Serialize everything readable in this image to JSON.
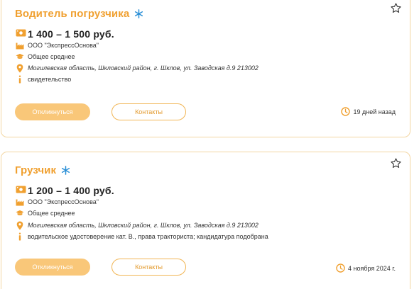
{
  "colors": {
    "accent": "#f0a030",
    "button_fill": "#f9c779",
    "border": "#f3d6a2",
    "spark": "#2a8fd6"
  },
  "vacancies": [
    {
      "title": "Водитель погрузчика",
      "salary": "1 400 – 1 500 руб.",
      "company": "ООО \"ЭкспрессОснова\"",
      "education": "Общее среднее",
      "address": "Могилевская область, Шкловский район, г. Шклов, ул. Заводская д.9 213002",
      "requirement": "свидетельство",
      "respond_label": "Откликнуться",
      "contacts_label": "Контакты",
      "date": "19 дней назад"
    },
    {
      "title": "Грузчик",
      "salary": "1 200 – 1 400 руб.",
      "company": "ООО \"ЭкспрессОснова\"",
      "education": "Общее среднее",
      "address": "Могилевская область, Шкловский район, г. Шклов, ул. Заводская д.9 213002",
      "requirement": "водительское удостоверение кат. В., права тракториста; кандидатура подобрана",
      "respond_label": "Откликнуться",
      "contacts_label": "Контакты",
      "date": "4 ноября 2024 г."
    }
  ]
}
